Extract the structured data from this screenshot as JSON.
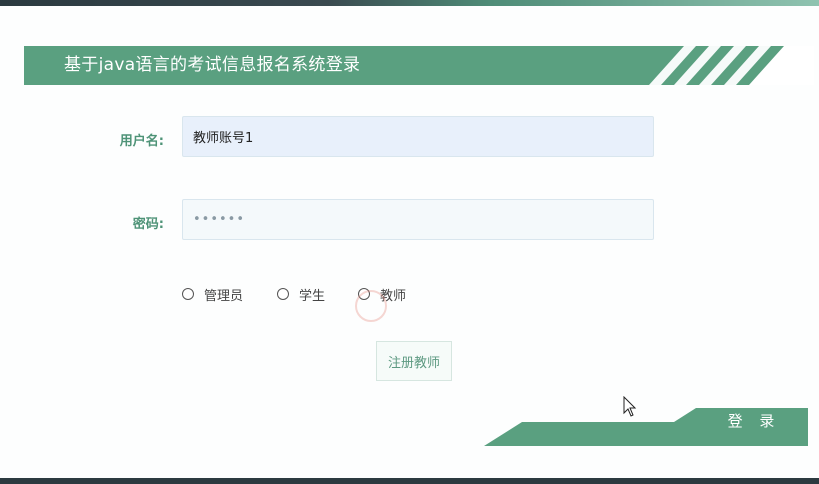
{
  "header": {
    "title": "基于java语言的考试信息报名系统登录"
  },
  "form": {
    "username_label": "用户名:",
    "username_value": "教师账号1",
    "password_label": "密码:",
    "password_value": "••••••"
  },
  "roles": [
    {
      "label": "管理员",
      "selected": false
    },
    {
      "label": "学生",
      "selected": false
    },
    {
      "label": "教师",
      "selected": false
    }
  ],
  "buttons": {
    "register": "注册教师",
    "login": "登 录"
  },
  "colors": {
    "accent": "#5aa080",
    "label": "#4e9377",
    "input_bg": "#e8f0fb"
  }
}
